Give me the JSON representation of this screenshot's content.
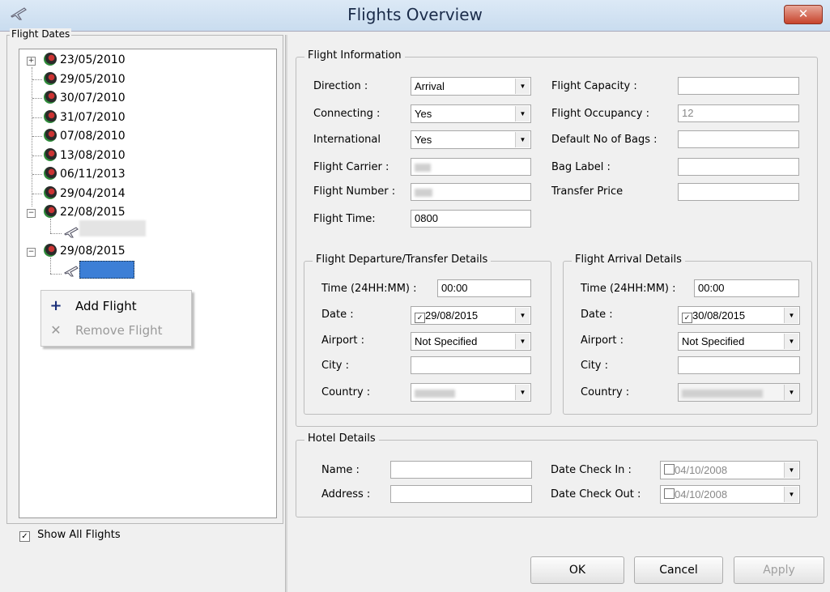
{
  "window": {
    "title": "Flights Overview",
    "close_label": "✕"
  },
  "left": {
    "legend": "Flight Dates",
    "tree": [
      "23/05/2010",
      "29/05/2010",
      "30/07/2010",
      "31/07/2010",
      "07/08/2010",
      "13/08/2010",
      "06/11/2013",
      "29/04/2014",
      "22/08/2015",
      "29/08/2015"
    ],
    "context_menu": {
      "add": "Add Flight",
      "remove": "Remove Flight"
    },
    "show_all": "Show All Flights"
  },
  "flight_info": {
    "legend": "Flight Information",
    "direction_label": "Direction :",
    "direction_value": "Arrival",
    "connecting_label": "Connecting :",
    "connecting_value": "Yes",
    "international_label": "International",
    "international_value": "Yes",
    "carrier_label": "Flight Carrier :",
    "number_label": "Flight Number :",
    "time_label": "Flight Time:",
    "time_value": "0800",
    "capacity_label": "Flight Capacity :",
    "occupancy_label": "Flight Occupancy :",
    "occupancy_value": "12",
    "bags_label": "Default No of Bags :",
    "bag_label_label": "Bag Label :",
    "transfer_price_label": "Transfer Price"
  },
  "departure": {
    "legend": "Flight Departure/Transfer Details",
    "time_label": "Time (24HH:MM) :",
    "time_value": "00:00",
    "date_label": "Date :",
    "date_value": "29/08/2015",
    "airport_label": "Airport :",
    "airport_value": "Not Specified",
    "city_label": "City :",
    "country_label": "Country :"
  },
  "arrival": {
    "legend": "Flight Arrival Details",
    "time_label": "Time (24HH:MM) :",
    "time_value": "00:00",
    "date_label": "Date :",
    "date_value": "30/08/2015",
    "airport_label": "Airport :",
    "airport_value": "Not Specified",
    "city_label": "City :",
    "country_label": "Country :"
  },
  "hotel": {
    "legend": "Hotel Details",
    "name_label": "Name :",
    "address_label": "Address :",
    "checkin_label": "Date Check In :",
    "checkin_value": "04/10/2008",
    "checkout_label": "Date Check Out :",
    "checkout_value": "04/10/2008"
  },
  "buttons": {
    "ok": "OK",
    "cancel": "Cancel",
    "apply": "Apply"
  },
  "icons": {
    "app": "plane-icon",
    "tree_node": "globe-icon",
    "tree_child": "plane-icon",
    "add": "plus-icon",
    "remove": "x-icon",
    "dropdown": "chevron-down-icon"
  },
  "colors": {
    "titlebar": "#c9dcef",
    "close": "#c7432c",
    "selection": "#3d7fd6",
    "add_icon": "#1a2f7a"
  }
}
